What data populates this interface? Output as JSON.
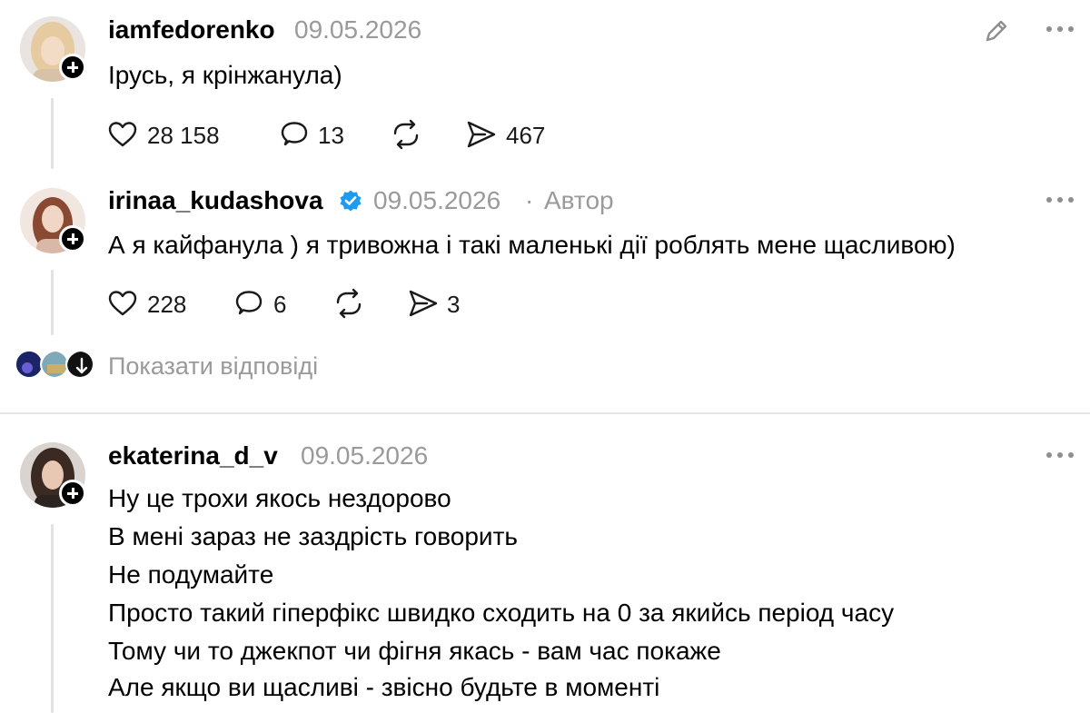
{
  "posts": [
    {
      "username": "iamfedorenko",
      "date": "09.05.2026",
      "text": "Ірусь, я крінжанула)",
      "likes": "28 158",
      "comments": "13",
      "shares": "467"
    },
    {
      "username": "irinaa_kudashova",
      "date": "09.05.2026",
      "separator": "·",
      "author_label": "Автор",
      "text": "А я кайфанула ) я тривожна і такі маленькі дії роблять мене щасливою)",
      "likes": "228",
      "comments": "6",
      "shares": "3",
      "show_replies": "Показати відповіді"
    },
    {
      "username": "ekaterina_d_v",
      "date": "09.05.2026",
      "lines": [
        "Ну це трохи якось нездорово",
        "В мені зараз не заздрість говорить",
        "Не подумайте",
        "Просто такий гіперфікс швидко сходить на 0 за якийсь період часу",
        "Тому чи то джекпот чи фігня якась - вам час покаже",
        "Але якщо ви щасливі - звісно будьте в моменті"
      ]
    }
  ],
  "icons": {
    "edit": "pencil-icon",
    "more": "more-icon",
    "like": "heart-icon",
    "comment": "comment-icon",
    "repost": "repost-icon",
    "share": "send-icon",
    "verified": "verified-badge-icon"
  },
  "colors": {
    "verified": "#1d9bf0",
    "muted": "#9a9a9a",
    "thread_line": "#e2e2e2"
  }
}
